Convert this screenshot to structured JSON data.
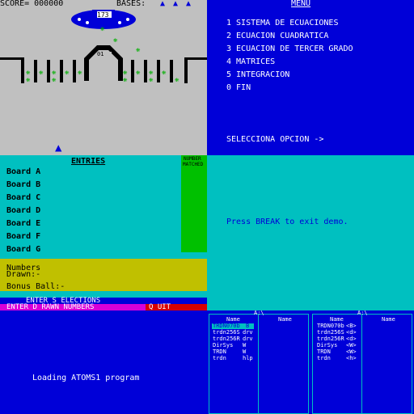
{
  "game": {
    "score_label": "SCORE= 000000",
    "bases_label": "BASES:",
    "bases_icons": [
      "ship-icon",
      "ship-icon",
      "ship-icon"
    ],
    "mothership_value": "173",
    "tunnel_value": "01"
  },
  "menu": {
    "title": "MENU",
    "items": [
      "1 SISTEMA DE ECUACIONES",
      "2 ECUACION CUADRATICA",
      "3 ECUACION DE TERCER GRADO",
      "4 MATRICES",
      "5 INTEGRACION",
      "0 FIN"
    ],
    "prompt": "SELECCIONA OPCION ->"
  },
  "lotto": {
    "title": "ENTRIES",
    "number_matched_label_1": "NUMBER",
    "number_matched_label_2": "MATCHED",
    "boards": [
      "Board A",
      "Board B",
      "Board C",
      "Board D",
      "Board E",
      "Board F",
      "Board G"
    ],
    "numbers_drawn_1": "Numbers",
    "numbers_drawn_2": "Drawn:-",
    "bonus_ball": "Bonus Ball:-",
    "enter_selections": "ENTER S ELECTIONS",
    "enter_drawn": "ENTER D RAWN NUMBERS",
    "quit": "Q UIT"
  },
  "demo": {
    "message": "Press BREAK to exit demo."
  },
  "loader": {
    "message": "Loading ATOMS1 program"
  },
  "files": {
    "left_panel": {
      "drive": "A:\\",
      "col1": "Name",
      "col2": "Name",
      "rows": [
        {
          "name": "TRDN070b",
          "ext": "B",
          "selected": true
        },
        {
          "name": "trdn256S",
          "ext": "drv",
          "selected": false
        },
        {
          "name": "trdn256R",
          "ext": "drv",
          "selected": false
        },
        {
          "name": "DirSys",
          "ext": "W",
          "selected": false
        },
        {
          "name": "TRDN",
          "ext": "W",
          "selected": false
        },
        {
          "name": "trdn",
          "ext": "hlp",
          "selected": false
        }
      ]
    },
    "right_panel": {
      "drive": "A:\\",
      "col1": "Name",
      "col2": "Name",
      "rows": [
        {
          "name": "TRDN070b",
          "ext": "<B>"
        },
        {
          "name": "trdn256S",
          "ext": "<d>"
        },
        {
          "name": "trdn256R",
          "ext": "<d>"
        },
        {
          "name": "DirSys",
          "ext": "<W>"
        },
        {
          "name": "TRDN",
          "ext": "<W>"
        },
        {
          "name": "trdn",
          "ext": "<h>"
        }
      ]
    }
  },
  "colors": {
    "spectrum_blue": "#0000d8",
    "spectrum_cyan": "#00c0c0",
    "spectrum_grey": "#c0c0c0",
    "spectrum_green": "#00c000",
    "spectrum_yellow": "#c0c000",
    "spectrum_red": "#d80000"
  }
}
